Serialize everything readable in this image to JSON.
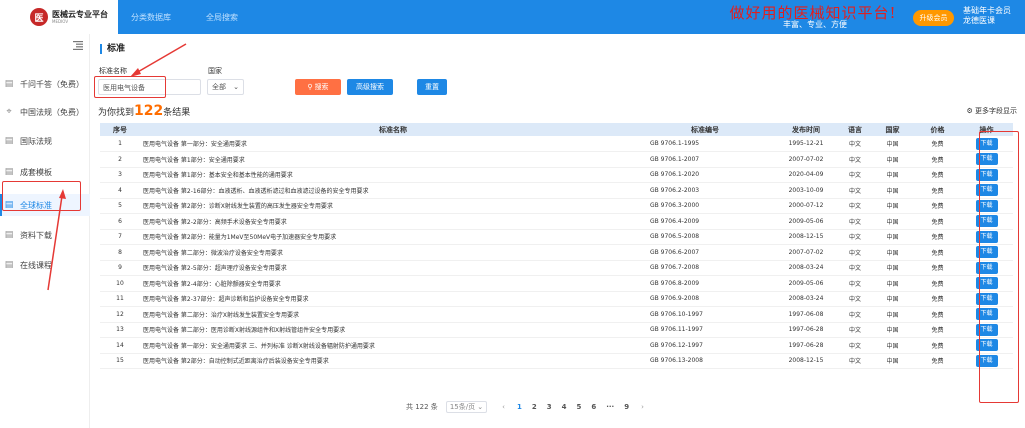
{
  "header": {
    "logo_name": "医械云专业平台",
    "logo_sub": "MEDIOV",
    "logo_mark": "医",
    "nav": [
      "分类数据库",
      "全局搜索"
    ],
    "slogan": "做好用的医械知识平台!",
    "slogan_sub": "丰富、专业、方便",
    "upgrade_label": "升级会员",
    "member_line1": "基础年卡会员",
    "member_line2": "龙德医课",
    "accent_color": "#1e88e5"
  },
  "sidebar": {
    "items": [
      {
        "label": "千问千答（免费）",
        "icon": "document-icon"
      },
      {
        "label": "中国法规（免费）",
        "icon": "location-icon"
      },
      {
        "label": "国际法规",
        "icon": "document-icon"
      },
      {
        "label": "成套模板",
        "icon": "document-icon"
      },
      {
        "label": "全球标准",
        "icon": "document-icon"
      },
      {
        "label": "资料下载",
        "icon": "document-icon"
      },
      {
        "label": "在线课程",
        "icon": "document-icon"
      }
    ],
    "active_index": 4
  },
  "main": {
    "section_title": "标准",
    "name_label": "标准名称",
    "name_value": "医用电气设备",
    "country_label": "国家",
    "country_value": "全部",
    "search_button": "搜索",
    "advanced_button": "高级搜索",
    "reset_button": "重置",
    "result_prefix": "为你找到",
    "result_count": "122",
    "result_suffix": "条结果",
    "more_fields": "更多字段显示"
  },
  "table": {
    "headers": [
      "序号",
      "标准名称",
      "标准编号",
      "发布时间",
      "语言",
      "国家",
      "价格",
      "操作"
    ],
    "download_label": "下载",
    "rows": [
      [
        "1",
        "医用电气设备 第一部分：安全通用要求",
        "GB 9706.1-1995",
        "1995-12-21",
        "中文",
        "中国",
        "免费"
      ],
      [
        "2",
        "医用电气设备 第1部分：安全通用要求",
        "GB 9706.1-2007",
        "2007-07-02",
        "中文",
        "中国",
        "免费"
      ],
      [
        "3",
        "医用电气设备 第1部分：基本安全和基本性能的通用要求",
        "GB 9706.1-2020",
        "2020-04-09",
        "中文",
        "中国",
        "免费"
      ],
      [
        "4",
        "医用电气设备 第2-16部分：血液透析、血液透析滤过和血液滤过设备的安全专用要求",
        "GB 9706.2-2003",
        "2003-10-09",
        "中文",
        "中国",
        "免费"
      ],
      [
        "5",
        "医用电气设备 第2部分：诊断X射线发生装置的高压发生器安全专用要求",
        "GB 9706.3-2000",
        "2000-07-12",
        "中文",
        "中国",
        "免费"
      ],
      [
        "6",
        "医用电气设备 第2-2部分：高频手术设备安全专用要求",
        "GB 9706.4-2009",
        "2009-05-06",
        "中文",
        "中国",
        "免费"
      ],
      [
        "7",
        "医用电气设备 第2部分：能量为1MeV至50MeV电子加速器安全专用要求",
        "GB 9706.5-2008",
        "2008-12-15",
        "中文",
        "中国",
        "免费"
      ],
      [
        "8",
        "医用电气设备 第二部分：微波治疗设备安全专用要求",
        "GB 9706.6-2007",
        "2007-07-02",
        "中文",
        "中国",
        "免费"
      ],
      [
        "9",
        "医用电气设备 第2-5部分：超声理疗设备安全专用要求",
        "GB 9706.7-2008",
        "2008-03-24",
        "中文",
        "中国",
        "免费"
      ],
      [
        "10",
        "医用电气设备 第2-4部分：心脏除颤器安全专用要求",
        "GB 9706.8-2009",
        "2009-05-06",
        "中文",
        "中国",
        "免费"
      ],
      [
        "11",
        "医用电气设备 第2-37部分：超声诊断和监护设备安全专用要求",
        "GB 9706.9-2008",
        "2008-03-24",
        "中文",
        "中国",
        "免费"
      ],
      [
        "12",
        "医用电气设备 第二部分：治疗X射线发生装置安全专用要求",
        "GB 9706.10-1997",
        "1997-06-08",
        "中文",
        "中国",
        "免费"
      ],
      [
        "13",
        "医用电气设备 第二部分：医用诊断X射线源组件和X射线管组件安全专用要求",
        "GB 9706.11-1997",
        "1997-06-28",
        "中文",
        "中国",
        "免费"
      ],
      [
        "14",
        "医用电气设备 第一部分：安全通用要求 三、并列标准 诊断X射线设备辐射防护通用要求",
        "GB 9706.12-1997",
        "1997-06-28",
        "中文",
        "中国",
        "免费"
      ],
      [
        "15",
        "医用电气设备 第2部分：自动控制式近距离治疗后装设备安全专用要求",
        "GB 9706.13-2008",
        "2008-12-15",
        "中文",
        "中国",
        "免费"
      ]
    ]
  },
  "pagination": {
    "total_label": "共 122 条",
    "page_size": "15条/页",
    "pages": [
      "1",
      "2",
      "3",
      "4",
      "5",
      "6",
      "···",
      "9"
    ],
    "current": "1",
    "prev": "‹",
    "next": "›"
  },
  "colors": {
    "primary": "#1e88e5",
    "search_button": "#ff7043",
    "annotation": "#e53935",
    "slogan": "#e02020"
  }
}
